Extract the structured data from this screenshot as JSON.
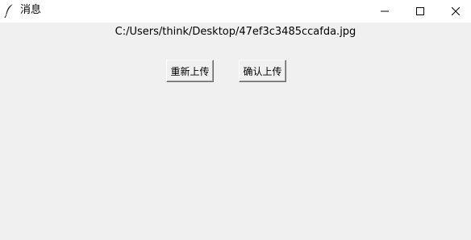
{
  "window": {
    "title": "消息",
    "icon": "feather-icon"
  },
  "titlebar_controls": {
    "minimize": "minimize-icon",
    "maximize": "maximize-icon",
    "close": "close-icon"
  },
  "content": {
    "file_path": "C:/Users/think/Desktop/47ef3c3485ccafda.jpg",
    "reupload_label": "重新上传",
    "confirm_label": "确认上传"
  }
}
